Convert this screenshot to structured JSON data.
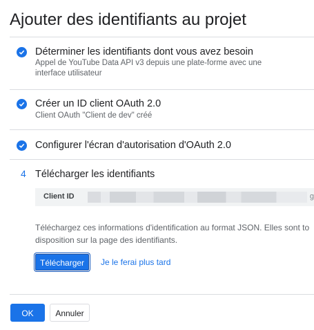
{
  "dialog": {
    "title": "Ajouter des identifiants au projet"
  },
  "steps": [
    {
      "status": "done",
      "title": "Déterminer les identifiants dont vous avez besoin",
      "subtitle": "Appel de YouTube Data API v3 depuis une plate-forme avec une interface utilisateur"
    },
    {
      "status": "done",
      "title": "Créer un ID client OAuth 2.0",
      "subtitle": "Client OAuth \"Client de dev\" créé"
    },
    {
      "status": "done",
      "title": "Configurer l'écran d'autorisation d'OAuth 2.0"
    },
    {
      "status": "current",
      "number": "4",
      "title": "Télécharger les identifiants",
      "client_id_label": "Client ID",
      "client_id_tail": "g",
      "info_line1": "Téléchargez ces informations d'identification au format JSON. Elles sont to",
      "info_line2": "disposition sur la page des identifiants.",
      "download_label": "Télécharger",
      "later_label": "Je le ferai plus tard"
    }
  ],
  "footer": {
    "ok_label": "OK",
    "cancel_label": "Annuler"
  },
  "colors": {
    "accent": "#1a73e8",
    "text": "#202124",
    "muted": "#5f6368"
  }
}
